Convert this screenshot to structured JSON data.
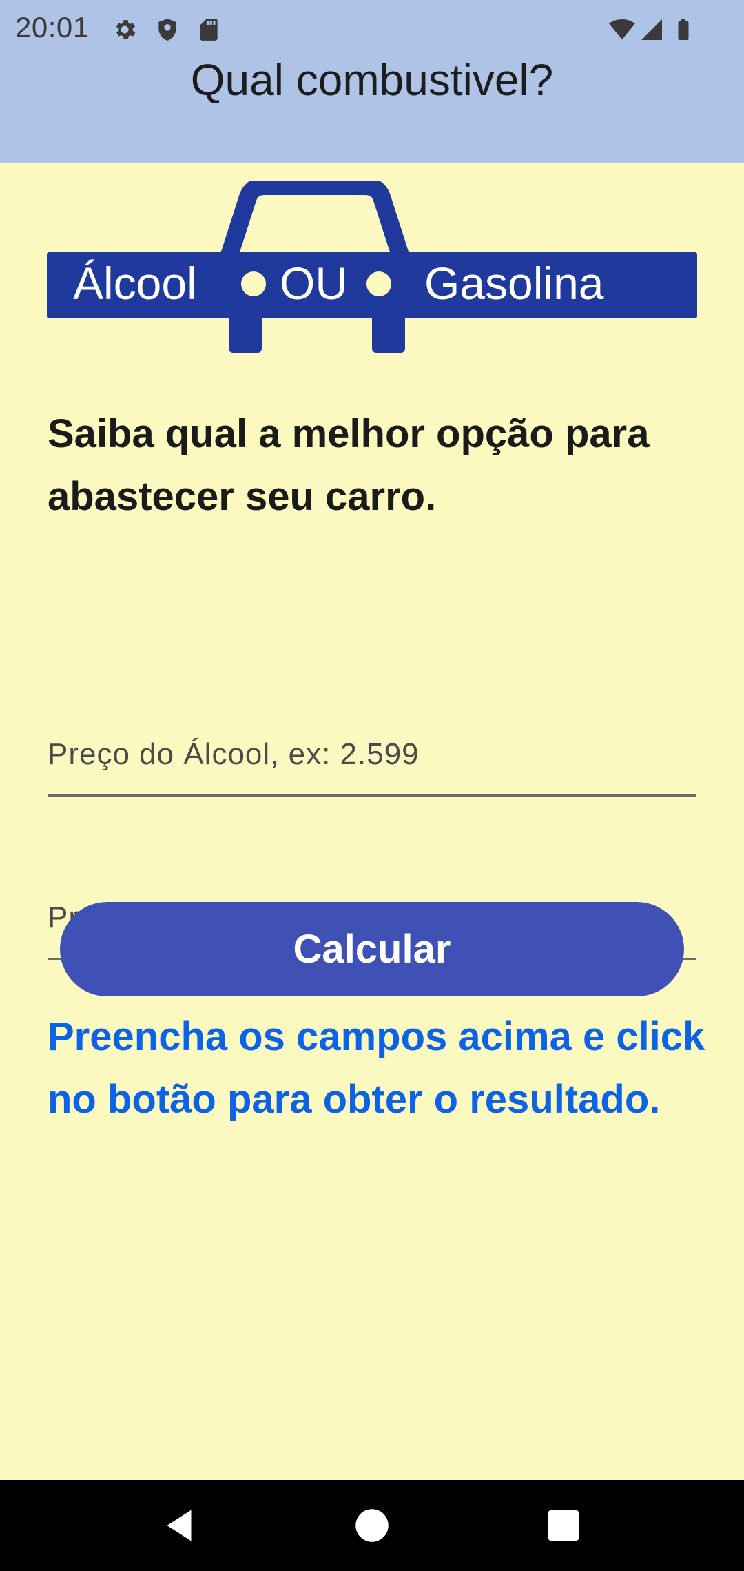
{
  "status_bar": {
    "time": "20:01",
    "left_icons": [
      "settings-icon",
      "shield-icon",
      "sd-card-icon"
    ],
    "right_icons": [
      "wifi-icon",
      "cell-signal-icon",
      "battery-icon"
    ]
  },
  "app_bar": {
    "title": "Qual combustivel?"
  },
  "logo": {
    "text_left": "Álcool",
    "text_middle": "OU",
    "text_right": "Gasolina",
    "brand_color": "#1f3a9c"
  },
  "main": {
    "headline": "Saiba qual a melhor opção para abastecer seu carro.",
    "alcool_field": {
      "placeholder": "Preço do Álcool, ex: 2.599",
      "value": ""
    },
    "gasolina_field": {
      "placeholder": "Preço da Gásolina, ex: 5.379",
      "value": ""
    },
    "calculate_button": "Calcular",
    "result_text": "Preencha os campos acima e click no botão para obter o resultado."
  },
  "nav_bar": {
    "icons": [
      "back-icon",
      "home-icon",
      "recents-icon"
    ]
  },
  "colors": {
    "status_bar_bg": "#afc3e6",
    "content_bg": "#fbf9c0",
    "button_bg": "#3f51b5",
    "result_text": "#0d63e6"
  }
}
